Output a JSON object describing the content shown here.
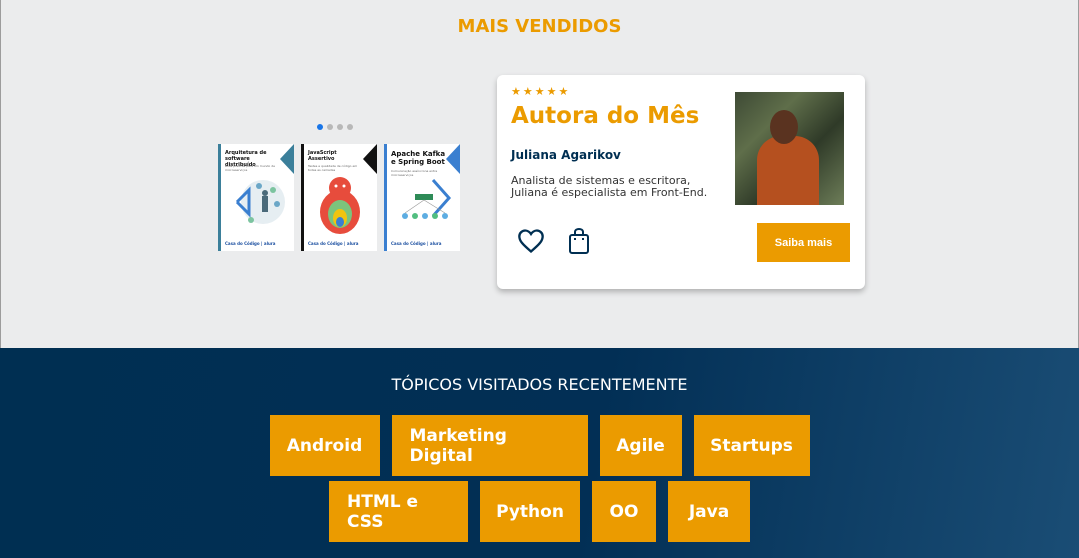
{
  "section": {
    "title": "MAIS VENDIDOS"
  },
  "carousel": {
    "dots": 4,
    "active": 1
  },
  "books": [
    {
      "title": "Arquitetura de software distribuído",
      "subtitle": "Boas práticas para um mundo de microsserviços",
      "publisher": "Casa do Código | alura",
      "accent": "#3b7f9a"
    },
    {
      "title": "JavaScript Assertivo",
      "subtitle": "Testes e qualidade de código em todas as camadas",
      "publisher": "Casa do Código | alura",
      "accent": "#111111"
    },
    {
      "title": "Apache Kafka e Spring Boot",
      "subtitle": "Comunicação assíncrona entre microsserviços",
      "publisher": "Casa do Código | alura",
      "accent": "#3a7fd0"
    }
  ],
  "card": {
    "stars": "★★★★★",
    "title": "Autora do Mês",
    "author": "Juliana Agarikov",
    "description": "Analista de sistemas e escritora, Juliana é especialista em Front-End.",
    "button": "Saiba mais",
    "favorite_icon": "heart-icon",
    "bag_icon": "shopping-bag-icon"
  },
  "topics": {
    "title": "TÓPICOS VISITADOS RECENTEMENTE",
    "row1": [
      "Android",
      "Marketing Digital",
      "Agile",
      "Startups"
    ],
    "row2": [
      "HTML e CSS",
      "Python",
      "OO",
      "Java"
    ]
  },
  "colors": {
    "accent": "#eb9b00",
    "navy": "#002f52",
    "dot_active": "#1875e8"
  }
}
